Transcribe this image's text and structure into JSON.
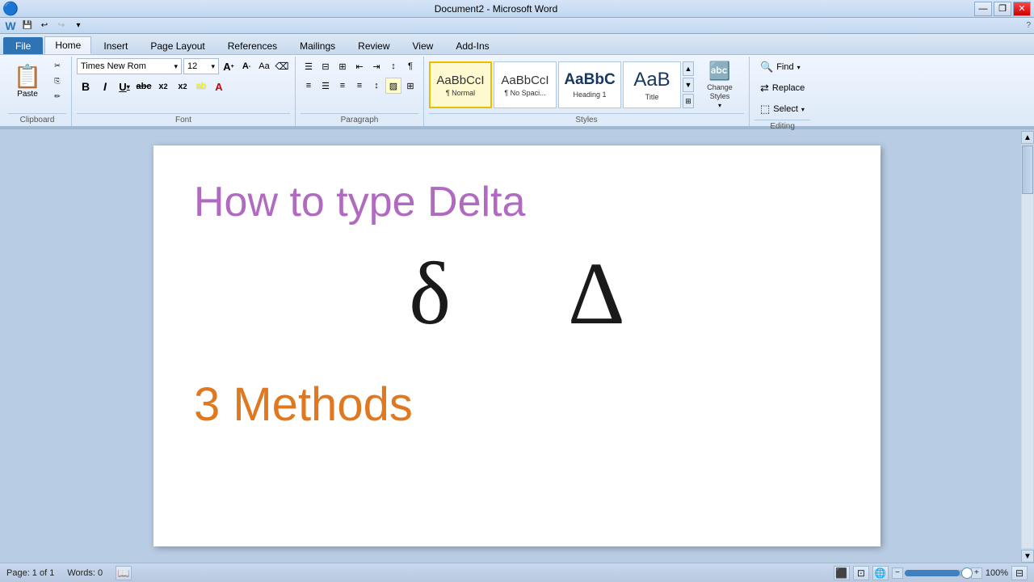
{
  "window": {
    "title": "Document2 - Microsoft Word",
    "minimize": "—",
    "restore": "❐",
    "close": "✕"
  },
  "qat": {
    "save": "💾",
    "undo": "↩",
    "redo": "↪",
    "dropdown": "▾"
  },
  "tabs": [
    {
      "label": "File",
      "type": "file"
    },
    {
      "label": "Home",
      "active": true
    },
    {
      "label": "Insert"
    },
    {
      "label": "Page Layout"
    },
    {
      "label": "References"
    },
    {
      "label": "Mailings"
    },
    {
      "label": "Review"
    },
    {
      "label": "View"
    },
    {
      "label": "Add-Ins"
    }
  ],
  "clipboard": {
    "group_label": "Clipboard",
    "paste_label": "Paste",
    "cut_label": "✂",
    "copy_label": "⎘",
    "format_painter_label": "✏"
  },
  "font": {
    "group_label": "Font",
    "family": "Times New Rom",
    "size": "12",
    "grow": "A",
    "shrink": "A",
    "change_case": "Aa",
    "clear": "⌫",
    "bold": "B",
    "italic": "I",
    "underline": "U",
    "strikethrough": "abc",
    "subscript": "x₂",
    "superscript": "x²",
    "highlight": "ab",
    "font_color": "A"
  },
  "paragraph": {
    "group_label": "Paragraph",
    "bullets": "≡",
    "numbering": "⊟",
    "multilevel": "⊠",
    "decrease_indent": "←",
    "increase_indent": "→",
    "sort": "↕",
    "show_marks": "¶",
    "align_left": "⬅",
    "align_center": "⬛",
    "align_right": "➡",
    "justify": "☰",
    "line_spacing": "↕",
    "shading": "▨",
    "borders": "⊞"
  },
  "styles": {
    "group_label": "Styles",
    "items": [
      {
        "label": "¶ Normal",
        "name": "Normal",
        "active": true
      },
      {
        "label": "¶ No Spaci...",
        "name": "No Spacing"
      },
      {
        "label": "Heading 1",
        "name": "Heading 1",
        "large": true
      },
      {
        "label": "Title",
        "name": "Title",
        "xlarge": true
      }
    ],
    "change_styles_label": "Change\nStyles"
  },
  "editing": {
    "group_label": "Editing",
    "find_label": "Find",
    "replace_label": "Replace",
    "select_label": "Select"
  },
  "document": {
    "heading": "How to type Delta",
    "delta_symbols": "δ  Δ",
    "methods": "3 Methods"
  },
  "status": {
    "page": "Page: 1 of 1",
    "words": "Words: 0",
    "spell_icon": "📖",
    "zoom": "100%"
  }
}
